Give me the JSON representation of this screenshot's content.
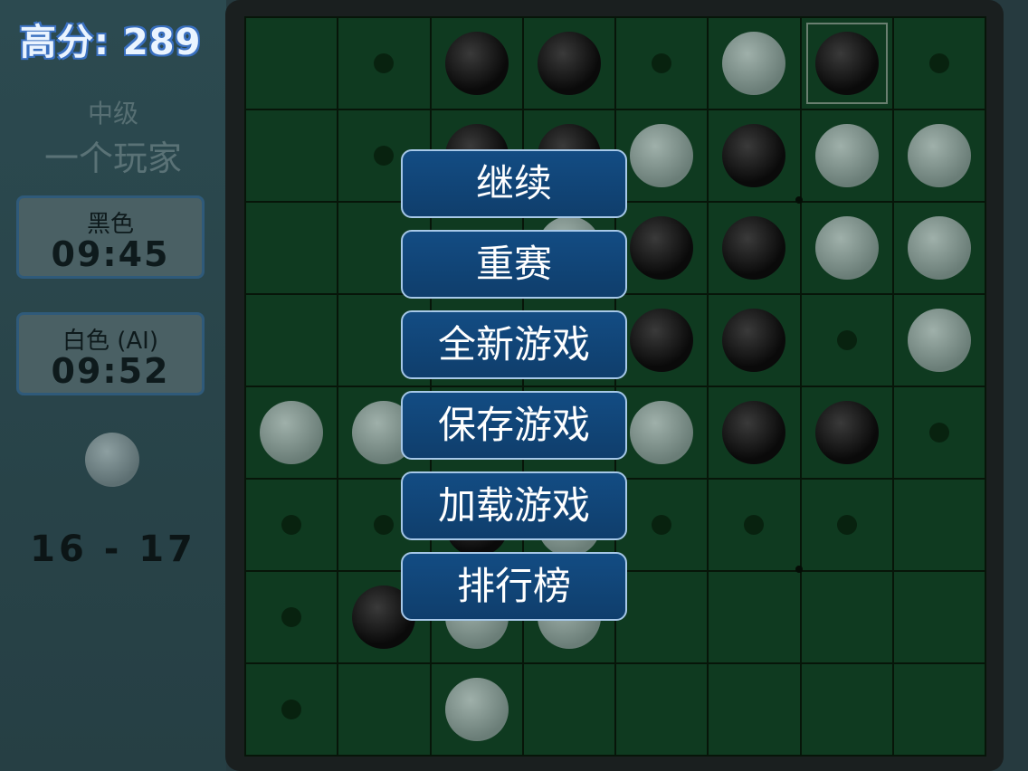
{
  "header": {
    "high_score_label": "高分: 289"
  },
  "info": {
    "level": "中级",
    "mode": "一个玩家"
  },
  "clocks": [
    {
      "label": "黑色",
      "time": "09:45"
    },
    {
      "label": "白色 (AI)",
      "time": "09:52"
    }
  ],
  "score": {
    "text": "16 - 17",
    "black": 16,
    "white": 17
  },
  "current_turn": "white",
  "board": [
    [
      "",
      ".",
      "B",
      "B",
      ".",
      "W",
      "B",
      "."
    ],
    [
      "",
      ".",
      "B",
      "B",
      "W",
      "B",
      "W",
      "W"
    ],
    [
      "",
      "",
      "",
      "W",
      "B",
      "B",
      "W",
      "W"
    ],
    [
      "",
      "",
      "",
      "",
      "B",
      "B",
      ".",
      "W"
    ],
    [
      "W",
      "W",
      "",
      "",
      "W",
      "B",
      "B",
      "."
    ],
    [
      ".",
      ".",
      "B",
      "W",
      ".",
      ".",
      ".",
      ""
    ],
    [
      ".",
      "B",
      "W",
      "W",
      "",
      "",
      "",
      ""
    ],
    [
      ".",
      "",
      "W",
      "",
      "",
      "",
      "",
      ""
    ]
  ],
  "highlight_cell": [
    0,
    6
  ],
  "menu": {
    "items": [
      "继续",
      "重赛",
      "全新游戏",
      "保存游戏",
      "加载游戏",
      "排行榜"
    ]
  }
}
